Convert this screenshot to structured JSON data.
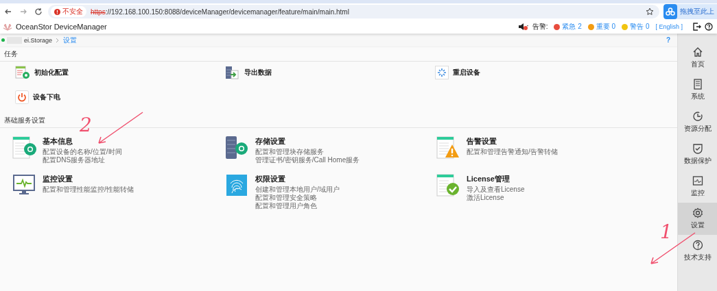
{
  "browser": {
    "security": "不安全",
    "url_scheme": "https",
    "url_rest": "://192.168.100.150:8088/deviceManager/devicemanager/feature/main/main.html",
    "extension": "拖拽至此上"
  },
  "app": {
    "title": "OceanStor DeviceManager",
    "alarm_label": "告警:",
    "alarms": [
      {
        "label": "紧急",
        "count": "2",
        "color": "#e84c3d"
      },
      {
        "label": "重要",
        "count": "0",
        "color": "#f39c12"
      },
      {
        "label": "警告",
        "count": "0",
        "color": "#f1c40f"
      }
    ],
    "language": "[ English ]"
  },
  "breadcrumb": {
    "device": "ei.Storage",
    "current": "设置",
    "help": "?"
  },
  "tasks": {
    "title": "任务",
    "items": [
      {
        "label": "初始化配置"
      },
      {
        "label": "导出数据"
      },
      {
        "label": "重启设备"
      },
      {
        "label": "设备下电"
      }
    ]
  },
  "services": {
    "title": "基础服务设置",
    "items": [
      {
        "title": "基本信息",
        "lines": [
          "配置设备的名称/位置/时间",
          "配置DNS服务器地址"
        ]
      },
      {
        "title": "存储设置",
        "lines": [
          "配置和管理块存储服务",
          "管理证书/密钥服务/Call Home服务"
        ]
      },
      {
        "title": "告警设置",
        "lines": [
          "配置和管理告警通知/告警转储"
        ]
      },
      {
        "title": "监控设置",
        "lines": [
          "配置和管理性能监控/性能转储"
        ]
      },
      {
        "title": "权限设置",
        "lines": [
          "创建和管理本地用户/域用户",
          "配置和管理安全策略",
          "配置和管理用户角色"
        ]
      },
      {
        "title": "License管理",
        "lines": [
          "导入及查看License",
          "激活License"
        ]
      }
    ]
  },
  "sidebar": {
    "items": [
      {
        "label": "首页",
        "selected": false
      },
      {
        "label": "系统",
        "selected": false
      },
      {
        "label": "资源分配",
        "selected": false
      },
      {
        "label": "数据保护",
        "selected": false
      },
      {
        "label": "监控",
        "selected": false
      },
      {
        "label": "设置",
        "selected": true
      },
      {
        "label": "技术支持",
        "selected": false
      }
    ]
  },
  "annotations": [
    {
      "label": "2"
    },
    {
      "label": "1"
    }
  ]
}
